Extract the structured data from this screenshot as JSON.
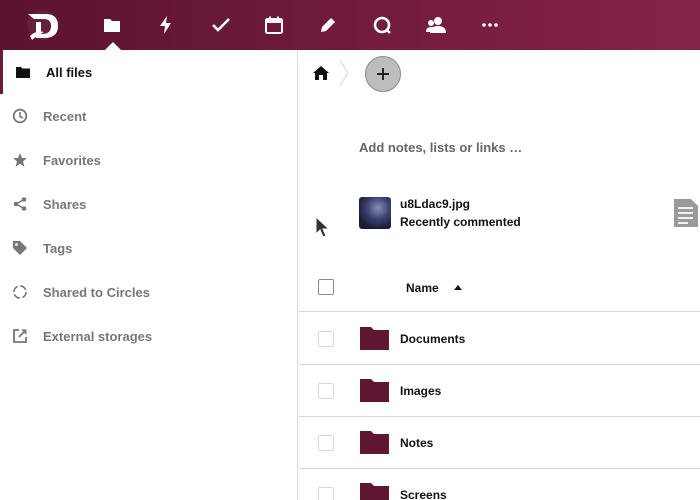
{
  "colors": {
    "header_start": "#5b1230",
    "header_end": "#862348",
    "folder": "#5e1633",
    "active_indicator": "#6b1a3b"
  },
  "header": {
    "logo": "nextcloud-logo",
    "nav": [
      {
        "icon": "folder-icon",
        "active": true
      },
      {
        "icon": "activity-icon"
      },
      {
        "icon": "tasks-check-icon"
      },
      {
        "icon": "calendar-icon"
      },
      {
        "icon": "notes-pencil-icon"
      },
      {
        "icon": "talk-icon"
      },
      {
        "icon": "contacts-icon"
      },
      {
        "icon": "more-icon"
      }
    ]
  },
  "sidebar": {
    "items": [
      {
        "label": "All files",
        "icon": "folder-icon",
        "active": true
      },
      {
        "label": "Recent",
        "icon": "clock-icon"
      },
      {
        "label": "Favorites",
        "icon": "star-icon"
      },
      {
        "label": "Shares",
        "icon": "share-icon"
      },
      {
        "label": "Tags",
        "icon": "tag-icon"
      },
      {
        "label": "Shared to Circles",
        "icon": "circles-icon"
      },
      {
        "label": "External storages",
        "icon": "external-link-icon"
      }
    ]
  },
  "main": {
    "notes_placeholder": "Add notes, lists or links …",
    "recent": {
      "name": "u8Ldac9.jpg",
      "subtitle": "Recently commented"
    },
    "list_header": {
      "name_label": "Name"
    },
    "files": [
      {
        "name": "Documents"
      },
      {
        "name": "Images"
      },
      {
        "name": "Notes"
      },
      {
        "name": "Screens"
      }
    ]
  }
}
